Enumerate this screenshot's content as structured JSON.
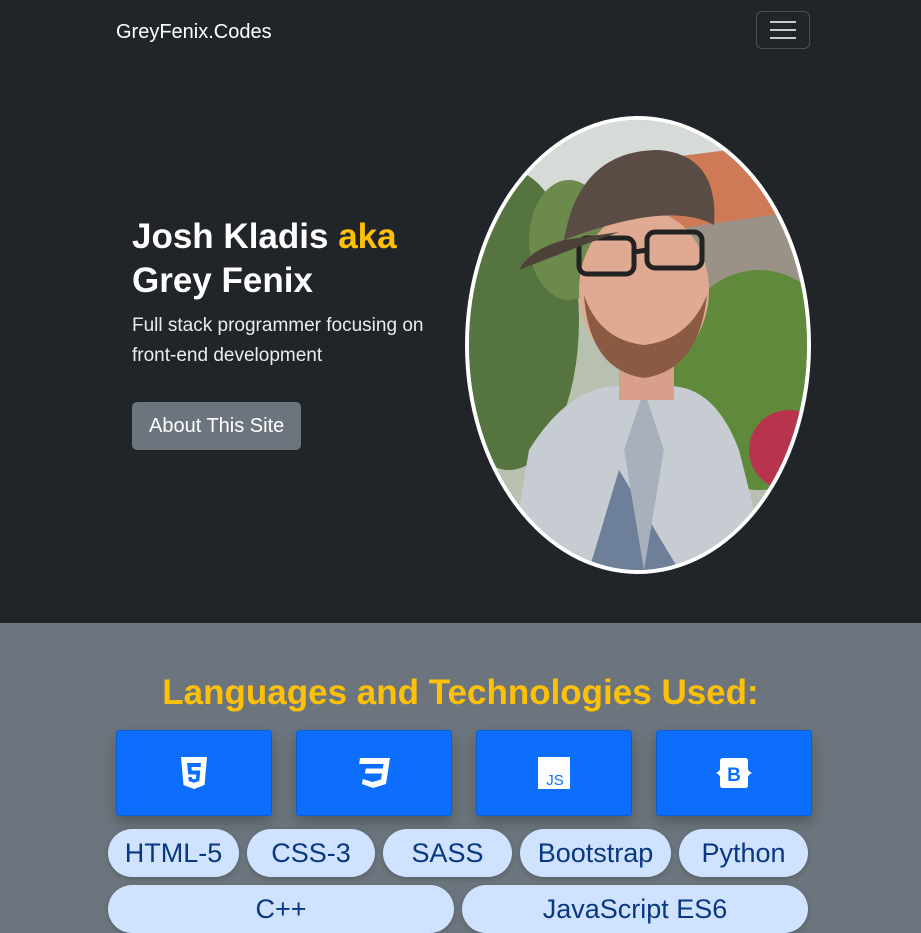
{
  "navbar": {
    "brand": "GreyFenix.Codes",
    "toggler_icon": "hamburger-menu-icon"
  },
  "hero": {
    "name": "Josh Kladis",
    "aka": "aka",
    "alias": "Grey Fenix",
    "subtitle": "Full stack programmer focusing on front-end development",
    "button_label": "About This Site",
    "portrait_icon": "profile-photo"
  },
  "tech": {
    "title": "Languages and Technologies Used:",
    "icons": [
      "html5-icon",
      "css3-icon",
      "javascript-icon",
      "bootstrap-icon"
    ],
    "pills": [
      {
        "label": "HTML-5"
      },
      {
        "label": "CSS-3"
      },
      {
        "label": "SASS"
      },
      {
        "label": "Bootstrap"
      },
      {
        "label": "Python"
      },
      {
        "label": "C++"
      },
      {
        "label": "JavaScript ES6"
      }
    ]
  },
  "colors": {
    "dark": "#212529",
    "gray": "#6c757d",
    "accent": "#ffc107",
    "primary": "#0d6efd",
    "pill_bg": "#cfe2ff",
    "pill_text": "#0a3781"
  }
}
